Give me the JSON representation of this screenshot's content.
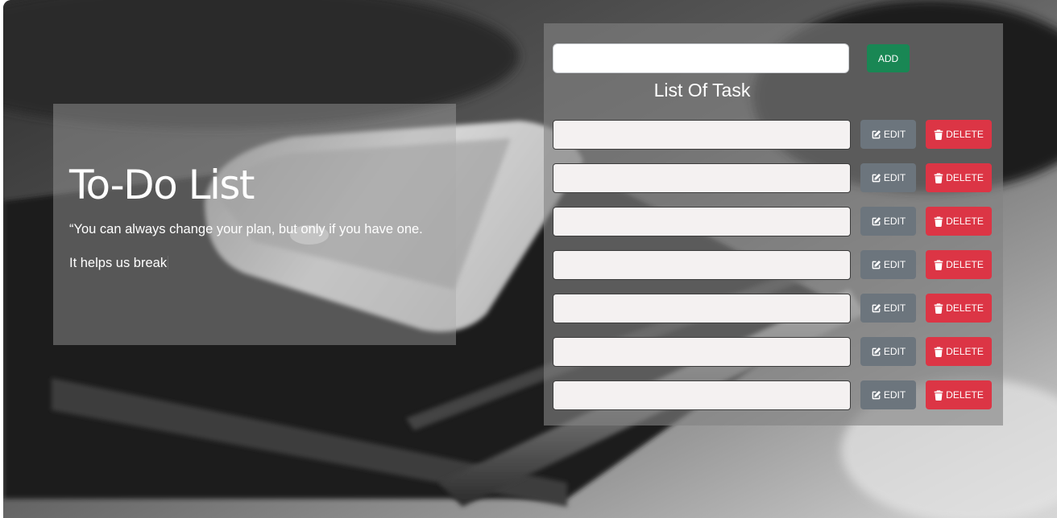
{
  "hero": {
    "title": "To-Do List",
    "quote": "“You can always change your plan, but only if you have one.",
    "line": "It helps us break"
  },
  "panel": {
    "new_task_placeholder": "",
    "new_task_value": "",
    "add_label": "ADD",
    "list_title": "List Of Task"
  },
  "tasks": [
    {
      "value": "",
      "edit_label": "EDIT",
      "delete_label": "DELETE"
    },
    {
      "value": "",
      "edit_label": "EDIT",
      "delete_label": "DELETE"
    },
    {
      "value": "",
      "edit_label": "EDIT",
      "delete_label": "DELETE"
    },
    {
      "value": "",
      "edit_label": "EDIT",
      "delete_label": "DELETE"
    },
    {
      "value": "",
      "edit_label": "EDIT",
      "delete_label": "DELETE"
    },
    {
      "value": "",
      "edit_label": "EDIT",
      "delete_label": "DELETE"
    },
    {
      "value": "",
      "edit_label": "EDIT",
      "delete_label": "DELETE"
    }
  ],
  "icons": {
    "edit": "edit-icon",
    "delete": "trash-icon"
  },
  "colors": {
    "add": "#198754",
    "edit": "#6c757d",
    "delete": "#dc3545",
    "task_field": "#f4f1f1"
  }
}
